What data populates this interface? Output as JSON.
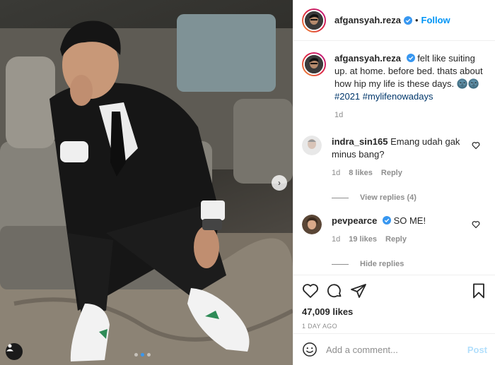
{
  "post": {
    "username": "afgansyah.reza",
    "follow_label": "Follow",
    "separator": "•"
  },
  "caption": {
    "username": "afgansyah.reza",
    "text": "felt like suiting up. at home. before bed. thats about how hip my life is these days. 🌚🌚 ",
    "hashtags": [
      "#2021",
      "#mylifenowadays"
    ],
    "age": "1d"
  },
  "comments": [
    {
      "username": "indra_sin165",
      "text": "Emang udah gak minus bang?",
      "age": "1d",
      "likes": "8 likes",
      "reply_label": "Reply",
      "replies_label": "View replies (4)",
      "verified": false
    },
    {
      "username": "pevpearce",
      "text": "SO ME!",
      "age": "1d",
      "likes": "19 likes",
      "reply_label": "Reply",
      "replies_label": "Hide replies",
      "verified": true
    }
  ],
  "stats": {
    "likes": "47,009 likes",
    "time_ago": "1 DAY AGO"
  },
  "composer": {
    "placeholder": "Add a comment...",
    "post_label": "Post"
  },
  "colors": {
    "accent": "#0095f6",
    "verified": "#3897f0",
    "muted": "#8e8e8e",
    "post_disabled": "#b2dffc"
  },
  "carousel": {
    "count": 3,
    "active_index": 1
  }
}
